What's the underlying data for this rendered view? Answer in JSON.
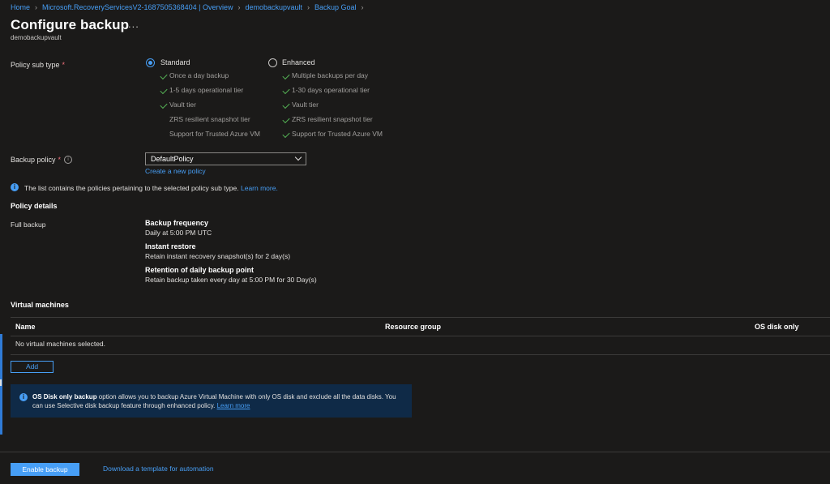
{
  "breadcrumb": [
    {
      "label": "Home"
    },
    {
      "label": "Microsoft.RecoveryServicesV2-1687505368404 | Overview"
    },
    {
      "label": "demobackupvault"
    },
    {
      "label": "Backup Goal"
    }
  ],
  "page": {
    "title": "Configure backup",
    "more": "...",
    "subtitle": "demobackupvault"
  },
  "policy_sub_type": {
    "label": "Policy sub type",
    "required": "*",
    "selected": "Standard",
    "options": [
      {
        "label": "Standard",
        "features": [
          {
            "text": "Once a day backup",
            "checked": true
          },
          {
            "text": "1-5 days operational tier",
            "checked": true
          },
          {
            "text": "Vault tier",
            "checked": true
          },
          {
            "text": "ZRS resilient snapshot tier",
            "checked": false
          },
          {
            "text": "Support for Trusted Azure VM",
            "checked": false
          }
        ]
      },
      {
        "label": "Enhanced",
        "features": [
          {
            "text": "Multiple backups per day",
            "checked": true
          },
          {
            "text": "1-30 days operational tier",
            "checked": true
          },
          {
            "text": "Vault tier",
            "checked": true
          },
          {
            "text": "ZRS resilient snapshot tier",
            "checked": true
          },
          {
            "text": "Support for Trusted Azure VM",
            "checked": true
          }
        ]
      }
    ]
  },
  "backup_policy": {
    "label": "Backup policy",
    "required": "*",
    "value": "DefaultPolicy",
    "create_link": "Create a new policy"
  },
  "info_note": {
    "text": "The list contains the policies pertaining to the selected policy sub type.",
    "link": "Learn more."
  },
  "policy_details": {
    "heading": "Policy details",
    "row_label": "Full backup",
    "items": [
      {
        "title": "Backup frequency",
        "value": "Daily at 5:00 PM UTC"
      },
      {
        "title": "Instant restore",
        "value": "Retain instant recovery snapshot(s) for 2 day(s)"
      },
      {
        "title": "Retention of daily backup point",
        "value": "Retain backup taken every day at 5:00 PM for 30 Day(s)"
      }
    ]
  },
  "vms": {
    "heading": "Virtual machines",
    "columns": [
      "Name",
      "Resource group",
      "OS disk only"
    ],
    "empty_text": "No virtual machines selected.",
    "add_label": "Add"
  },
  "banner": {
    "bold": "OS Disk only backup",
    "text": " option allows you to backup Azure Virtual Machine with only OS disk and exclude all the data disks. You can use Selective disk backup feature through enhanced policy. ",
    "link": "Learn more"
  },
  "footer": {
    "enable_label": "Enable backup",
    "download_link": "Download a template for automation"
  },
  "colors": {
    "accent": "#479ef5",
    "background": "#1b1a19",
    "check": "#54b054",
    "banner": "#0f2a47"
  }
}
